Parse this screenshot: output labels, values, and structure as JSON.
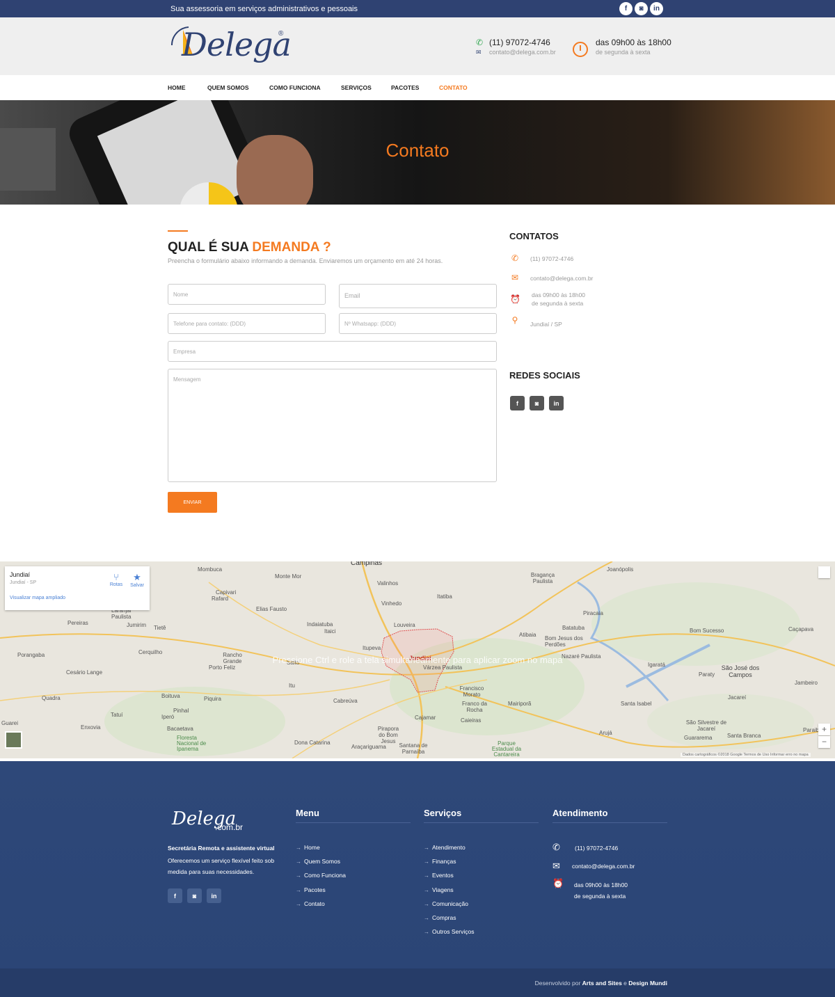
{
  "topbar": {
    "tagline": "Sua assessoria em serviços administrativos e pessoais",
    "socials": [
      {
        "icon": "facebook-icon",
        "glyph": "f"
      },
      {
        "icon": "instagram-icon",
        "glyph": "◙"
      },
      {
        "icon": "linkedin-icon",
        "glyph": "in"
      }
    ]
  },
  "header": {
    "logo_text": "Delega",
    "logo_reg": "®",
    "phone": "(11) 97072-4746",
    "email": "contato@delega.com.br",
    "hours": "das 09h00 às 18h00",
    "days": "de segunda à sexta"
  },
  "nav": {
    "items": [
      "HOME",
      "QUEM SOMOS",
      "COMO FUNCIONA",
      "SERVIÇOS",
      "PACOTES",
      "CONTATO"
    ],
    "active": "CONTATO"
  },
  "hero": {
    "title": "Contato"
  },
  "form": {
    "title_part1": "QUAL É SUA ",
    "title_highlight": "DEMANDA ?",
    "subtitle": "Preencha o formulário abaixo informando a demanda. Enviaremos um orçamento em até 24 horas.",
    "placeholders": {
      "name": "Nome",
      "email": "Email",
      "phone": "Telefone para contato: (DDD)",
      "whatsapp": "Nº Whatsapp: (DDD)",
      "company": "Empresa",
      "message": "Mensagem"
    },
    "submit": "ENVIAR"
  },
  "sidebar": {
    "contacts_title": "CONTATOS",
    "phone": "(11) 97072-4746",
    "email": "contato@delega.com.br",
    "hours": "das 09h00 às 18h00",
    "days": "de segunda à sexta",
    "location": "Jundiaí / SP",
    "social_title": "REDES SOCIAIS"
  },
  "map": {
    "place_title": "Jundiaí",
    "place_sub": "Jundiaí - SP",
    "enlarge_link": "Visualizar mapa ampliado",
    "directions": "Rotas",
    "save": "Salvar",
    "overlay_msg": "Pressione Ctrl e role a tela simultaneamente para aplicar zoom no mapa",
    "credits": "Dados cartográficos ©2018 Google   Termos de Uso   Informar erro no mapa",
    "zoom_in": "+",
    "zoom_out": "−",
    "places": [
      "Campinas",
      "Mombuca",
      "Monte Mor",
      "Valinhos",
      "Bragança Paulista",
      "Joanópolis",
      "Vinhedo",
      "Itatiba",
      "Capivari",
      "Rafard",
      "Elias Fausto",
      "Indaiatuba",
      "Louveira",
      "Piracaia",
      "Laranjal Paulista",
      "Jumirim",
      "Tietê",
      "Itaici",
      "Atibaia",
      "Bom Jesus dos Perdões",
      "Batatuba",
      "Bom Sucesso",
      "Caçapava",
      "Pereiras",
      "Cerquilho",
      "Rancho Grande",
      "Porto Feliz",
      "Itupeva",
      "Jundiaí",
      "Várzea Paulista",
      "Nazaré Paulista",
      "Igaratá",
      "São José dos Campos",
      "Paraty",
      "Jambeiro",
      "Porangaba",
      "Cesário Lange",
      "Salto",
      "Jacareí",
      "Quadra",
      "Boituva",
      "Itu",
      "Cabreúva",
      "Francisco Morato",
      "Franco da Rocha",
      "Mairiporã",
      "Santa Isabel",
      "Piquira",
      "Tatuí",
      "Iperó",
      "Pinhal",
      "Cajamar",
      "Caieiras",
      "Arujá",
      "São Silvestre de Jacareí",
      "Guararema",
      "Santa Branca",
      "Paraibuna",
      "Araçariguama",
      "Pirapora do Bom Jesus",
      "Enxovia",
      "Bacaetava",
      "Floresta Nacional de Ipanema",
      "Dona Catarina",
      "Santana de Parnaíba",
      "Parque Estadual da Cantareira",
      "Guarei"
    ]
  },
  "footer": {
    "logo_text": "Delega",
    "logo_suffix": ".com.br",
    "tagline_bold": "Secretária Remota e assistente virtual",
    "tagline": "Oferecemos um serviço flexível feito sob medida para suas necessidades.",
    "menu_title": "Menu",
    "menu": [
      "Home",
      "Quem Somos",
      "Como Funciona",
      "Pacotes",
      "Contato"
    ],
    "services_title": "Serviços",
    "services": [
      "Atendimento",
      "Finanças",
      "Eventos",
      "Viagens",
      "Comunicação",
      "Compras",
      "Outros Serviços"
    ],
    "service_title": "Atendimento",
    "phone": "(11) 97072-4746",
    "email": "contato@delega.com.br",
    "hours": "das 09h00 às 18h00",
    "days": "de segunda à sexta",
    "credit_prefix": "Desenvolvido por ",
    "credit_a": "Arts and Sites",
    "credit_mid": " e ",
    "credit_b": "Design Mundi"
  },
  "colors": {
    "brand_blue": "#2f4272",
    "accent_orange": "#f47a20"
  }
}
